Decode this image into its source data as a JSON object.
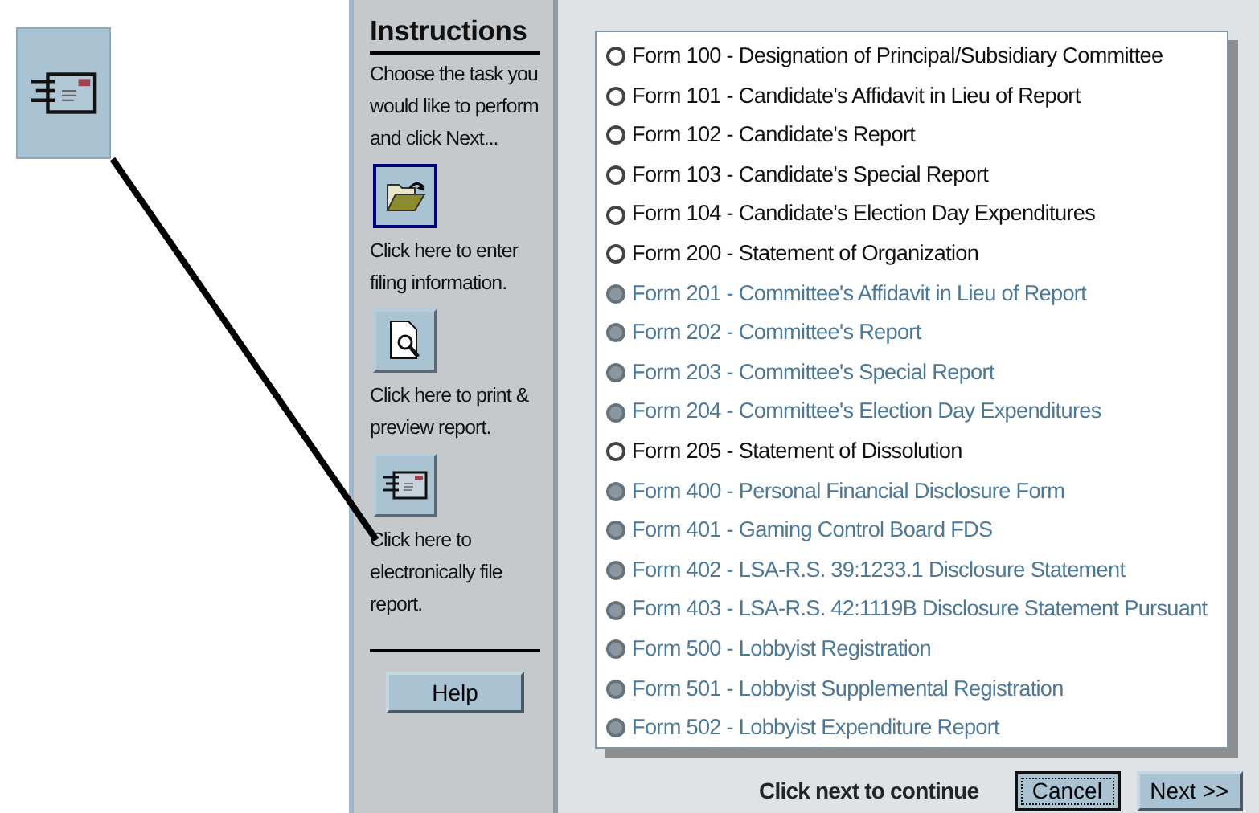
{
  "sidebar": {
    "title": "Instructions",
    "intro": "Choose the task you would like to perform and click Next...",
    "tasks": [
      {
        "kind": "open",
        "label": "Click here to enter filing information.",
        "selected": true
      },
      {
        "kind": "preview",
        "label": "Click here to print & preview report.",
        "selected": false
      },
      {
        "kind": "efile",
        "label": "Click here to electronically file report.",
        "selected": false
      }
    ],
    "help_button": "Help"
  },
  "forms": [
    {
      "label": "Form 100 - Designation of Principal/Subsidiary Committee",
      "disabled": false
    },
    {
      "label": "Form 101 - Candidate's Affidavit in Lieu of Report",
      "disabled": false
    },
    {
      "label": "Form 102 - Candidate's Report",
      "disabled": false
    },
    {
      "label": "Form 103 - Candidate's Special Report",
      "disabled": false
    },
    {
      "label": "Form 104 - Candidate's Election Day Expenditures",
      "disabled": false
    },
    {
      "label": "Form 200 - Statement of Organization",
      "disabled": false
    },
    {
      "label": "Form 201 - Committee's Affidavit in Lieu of Report",
      "disabled": true
    },
    {
      "label": "Form 202 - Committee's Report",
      "disabled": true
    },
    {
      "label": "Form 203 - Committee's Special Report",
      "disabled": true
    },
    {
      "label": "Form 204 - Committee's Election Day Expenditures",
      "disabled": true
    },
    {
      "label": "Form 205 - Statement of Dissolution",
      "disabled": false
    },
    {
      "label": "Form 400 - Personal Financial Disclosure Form",
      "disabled": true
    },
    {
      "label": "Form 401 - Gaming Control Board FDS",
      "disabled": true
    },
    {
      "label": "Form 402 - LSA-R.S. 39:1233.1 Disclosure Statement",
      "disabled": true
    },
    {
      "label": "Form 403 - LSA-R.S. 42:1119B Disclosure Statement Pursuant",
      "disabled": true
    },
    {
      "label": "Form 500 - Lobbyist Registration",
      "disabled": true
    },
    {
      "label": "Form 501 - Lobbyist Supplemental Registration",
      "disabled": true
    },
    {
      "label": "Form 502 - Lobbyist Expenditure Report",
      "disabled": true
    }
  ],
  "footer": {
    "hint": "Click next to continue",
    "buttons": [
      {
        "label": "Cancel",
        "focused": true
      },
      {
        "label": "Next >>",
        "focused": false
      }
    ]
  }
}
